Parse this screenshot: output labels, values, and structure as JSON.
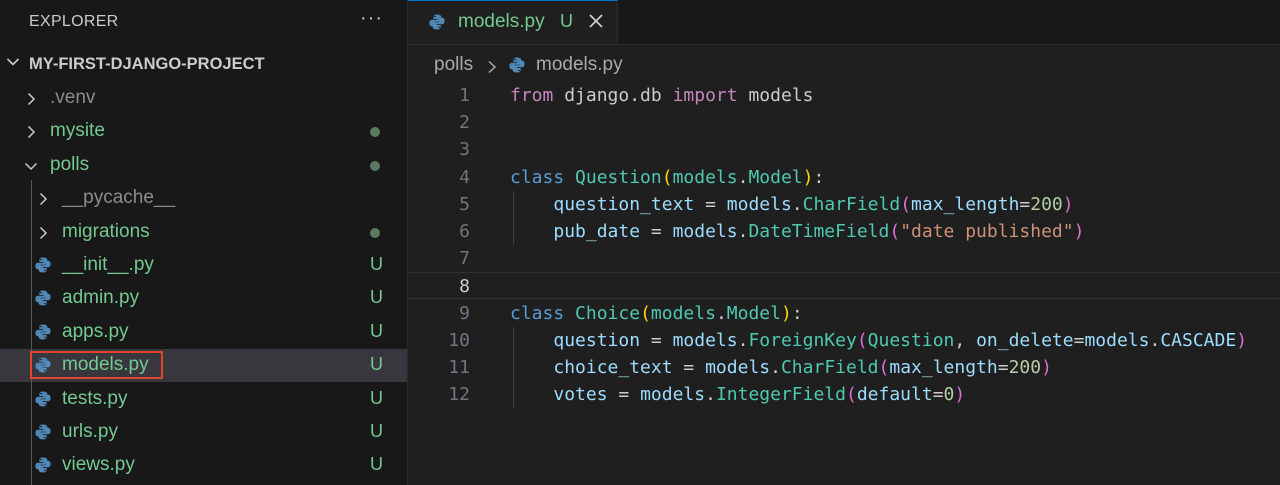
{
  "sidebar": {
    "title": "EXPLORER",
    "more_actions": "···",
    "project": "MY-FIRST-DJANGO-PROJECT",
    "items": [
      {
        "name": ".venv",
        "type": "folder",
        "depth": 1,
        "expanded": false,
        "status": "",
        "color": "ignored"
      },
      {
        "name": "mysite",
        "type": "folder",
        "depth": 1,
        "expanded": false,
        "status": "dot",
        "color": "untracked"
      },
      {
        "name": "polls",
        "type": "folder",
        "depth": 1,
        "expanded": true,
        "status": "dot",
        "color": "untracked"
      },
      {
        "name": "__pycache__",
        "type": "folder",
        "depth": 2,
        "expanded": false,
        "status": "",
        "color": "ignored"
      },
      {
        "name": "migrations",
        "type": "folder",
        "depth": 2,
        "expanded": false,
        "status": "dot",
        "color": "untracked"
      },
      {
        "name": "__init__.py",
        "type": "py",
        "depth": 2,
        "status": "U",
        "color": "untracked"
      },
      {
        "name": "admin.py",
        "type": "py",
        "depth": 2,
        "status": "U",
        "color": "untracked"
      },
      {
        "name": "apps.py",
        "type": "py",
        "depth": 2,
        "status": "U",
        "color": "untracked"
      },
      {
        "name": "models.py",
        "type": "py",
        "depth": 2,
        "status": "U",
        "color": "untracked",
        "selected": true
      },
      {
        "name": "tests.py",
        "type": "py",
        "depth": 2,
        "status": "U",
        "color": "untracked"
      },
      {
        "name": "urls.py",
        "type": "py",
        "depth": 2,
        "status": "U",
        "color": "untracked"
      },
      {
        "name": "views.py",
        "type": "py",
        "depth": 2,
        "status": "U",
        "color": "untracked"
      }
    ]
  },
  "editor": {
    "tab": {
      "label": "models.py",
      "status": "U"
    },
    "breadcrumb": {
      "folder": "polls",
      "file": "models.py"
    },
    "current_line": 8,
    "lines": [
      [
        [
          "kw2",
          "from"
        ],
        [
          "plain",
          " django.db "
        ],
        [
          "kw2",
          "import"
        ],
        [
          "plain",
          " models"
        ]
      ],
      [],
      [],
      [
        [
          "kw",
          "class"
        ],
        [
          "plain",
          " "
        ],
        [
          "cls",
          "Question"
        ],
        [
          "p1",
          "("
        ],
        [
          "cls",
          "models"
        ],
        [
          "plain",
          "."
        ],
        [
          "cls",
          "Model"
        ],
        [
          "p1",
          ")"
        ],
        [
          "plain",
          ":"
        ]
      ],
      [
        [
          "plain",
          "    "
        ],
        [
          "var",
          "question_text"
        ],
        [
          "plain",
          " = "
        ],
        [
          "var",
          "models"
        ],
        [
          "plain",
          "."
        ],
        [
          "cls",
          "CharField"
        ],
        [
          "p2",
          "("
        ],
        [
          "var",
          "max_length"
        ],
        [
          "plain",
          "="
        ],
        [
          "num",
          "200"
        ],
        [
          "p2",
          ")"
        ]
      ],
      [
        [
          "plain",
          "    "
        ],
        [
          "var",
          "pub_date"
        ],
        [
          "plain",
          " = "
        ],
        [
          "var",
          "models"
        ],
        [
          "plain",
          "."
        ],
        [
          "cls",
          "DateTimeField"
        ],
        [
          "p2",
          "("
        ],
        [
          "str",
          "\"date published\""
        ],
        [
          "p2",
          ")"
        ]
      ],
      [],
      [],
      [
        [
          "kw",
          "class"
        ],
        [
          "plain",
          " "
        ],
        [
          "cls",
          "Choice"
        ],
        [
          "p1",
          "("
        ],
        [
          "cls",
          "models"
        ],
        [
          "plain",
          "."
        ],
        [
          "cls",
          "Model"
        ],
        [
          "p1",
          ")"
        ],
        [
          "plain",
          ":"
        ]
      ],
      [
        [
          "plain",
          "    "
        ],
        [
          "var",
          "question"
        ],
        [
          "plain",
          " = "
        ],
        [
          "var",
          "models"
        ],
        [
          "plain",
          "."
        ],
        [
          "cls",
          "ForeignKey"
        ],
        [
          "p2",
          "("
        ],
        [
          "cls",
          "Question"
        ],
        [
          "plain",
          ", "
        ],
        [
          "var",
          "on_delete"
        ],
        [
          "plain",
          "="
        ],
        [
          "var",
          "models"
        ],
        [
          "plain",
          "."
        ],
        [
          "var",
          "CASCADE"
        ],
        [
          "p2",
          ")"
        ]
      ],
      [
        [
          "plain",
          "    "
        ],
        [
          "var",
          "choice_text"
        ],
        [
          "plain",
          " = "
        ],
        [
          "var",
          "models"
        ],
        [
          "plain",
          "."
        ],
        [
          "cls",
          "CharField"
        ],
        [
          "p2",
          "("
        ],
        [
          "var",
          "max_length"
        ],
        [
          "plain",
          "="
        ],
        [
          "num",
          "200"
        ],
        [
          "p2",
          ")"
        ]
      ],
      [
        [
          "plain",
          "    "
        ],
        [
          "var",
          "votes"
        ],
        [
          "plain",
          " = "
        ],
        [
          "var",
          "models"
        ],
        [
          "plain",
          "."
        ],
        [
          "cls",
          "IntegerField"
        ],
        [
          "p2",
          "("
        ],
        [
          "var",
          "default"
        ],
        [
          "plain",
          "="
        ],
        [
          "num",
          "0"
        ],
        [
          "p2",
          ")"
        ]
      ]
    ]
  },
  "colors": {
    "accent": "#0078d4",
    "untracked": "#73c991",
    "selection_box": "#e0442c"
  },
  "icons": {
    "file": "python-icon",
    "folder_closed": "chevron-right-icon",
    "folder_open": "chevron-down-icon",
    "close": "close-icon"
  }
}
